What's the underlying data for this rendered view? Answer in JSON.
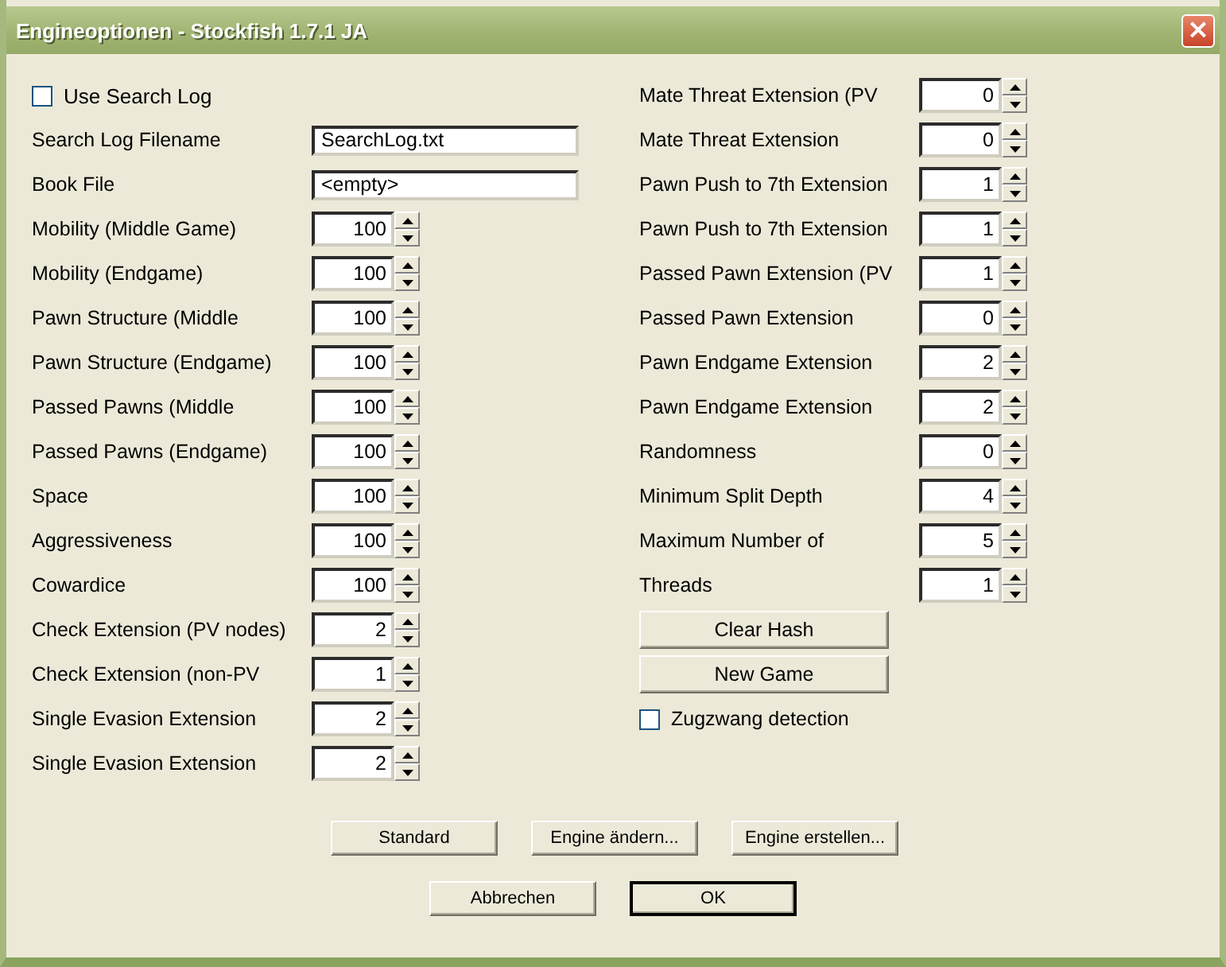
{
  "window": {
    "title": "Engineoptionen - Stockfish 1.7.1 JA",
    "close": "×"
  },
  "left_options": [
    {
      "kind": "checkbox",
      "label": "Use Search Log",
      "checked": false
    },
    {
      "kind": "text",
      "label": "Search Log Filename",
      "value": "SearchLog.txt"
    },
    {
      "kind": "text",
      "label": "Book File",
      "value": "<empty>"
    },
    {
      "kind": "spin",
      "label": "Mobility (Middle Game)",
      "value": "100"
    },
    {
      "kind": "spin",
      "label": "Mobility (Endgame)",
      "value": "100"
    },
    {
      "kind": "spin",
      "label": "Pawn Structure (Middle",
      "value": "100"
    },
    {
      "kind": "spin",
      "label": "Pawn Structure (Endgame)",
      "value": "100"
    },
    {
      "kind": "spin",
      "label": "Passed Pawns (Middle",
      "value": "100"
    },
    {
      "kind": "spin",
      "label": "Passed Pawns (Endgame)",
      "value": "100"
    },
    {
      "kind": "spin",
      "label": "Space",
      "value": "100"
    },
    {
      "kind": "spin",
      "label": "Aggressiveness",
      "value": "100"
    },
    {
      "kind": "spin",
      "label": "Cowardice",
      "value": "100"
    },
    {
      "kind": "spin",
      "label": "Check Extension (PV nodes)",
      "value": "2"
    },
    {
      "kind": "spin",
      "label": "Check Extension (non-PV",
      "value": "1"
    },
    {
      "kind": "spin",
      "label": "Single Evasion Extension",
      "value": "2"
    },
    {
      "kind": "spin",
      "label": "Single Evasion Extension",
      "value": "2"
    }
  ],
  "right_options": [
    {
      "kind": "spin",
      "label": "Mate Threat Extension (PV",
      "value": "0"
    },
    {
      "kind": "spin",
      "label": "Mate Threat Extension",
      "value": "0"
    },
    {
      "kind": "spin",
      "label": "Pawn Push to 7th Extension",
      "value": "1"
    },
    {
      "kind": "spin",
      "label": "Pawn Push to 7th Extension",
      "value": "1"
    },
    {
      "kind": "spin",
      "label": "Passed Pawn Extension (PV",
      "value": "1"
    },
    {
      "kind": "spin",
      "label": "Passed Pawn Extension",
      "value": "0"
    },
    {
      "kind": "spin",
      "label": "Pawn Endgame Extension",
      "value": "2"
    },
    {
      "kind": "spin",
      "label": "Pawn Endgame Extension",
      "value": "2"
    },
    {
      "kind": "spin",
      "label": "Randomness",
      "value": "0"
    },
    {
      "kind": "spin",
      "label": "Minimum Split Depth",
      "value": "4"
    },
    {
      "kind": "spin",
      "label": "Maximum Number of",
      "value": "5"
    },
    {
      "kind": "spin",
      "label": "Threads",
      "value": "1"
    },
    {
      "kind": "button",
      "label": "Clear Hash"
    },
    {
      "kind": "button",
      "label": "New Game"
    },
    {
      "kind": "checkbox",
      "label": "Zugzwang detection",
      "checked": false
    }
  ],
  "buttons_row1": [
    {
      "label": "Standard",
      "default": false
    },
    {
      "label": "Engine ändern...",
      "default": false
    },
    {
      "label": "Engine erstellen...",
      "default": false
    }
  ],
  "buttons_row2": [
    {
      "label": "Abbrechen",
      "default": false
    },
    {
      "label": "OK",
      "default": true
    }
  ]
}
